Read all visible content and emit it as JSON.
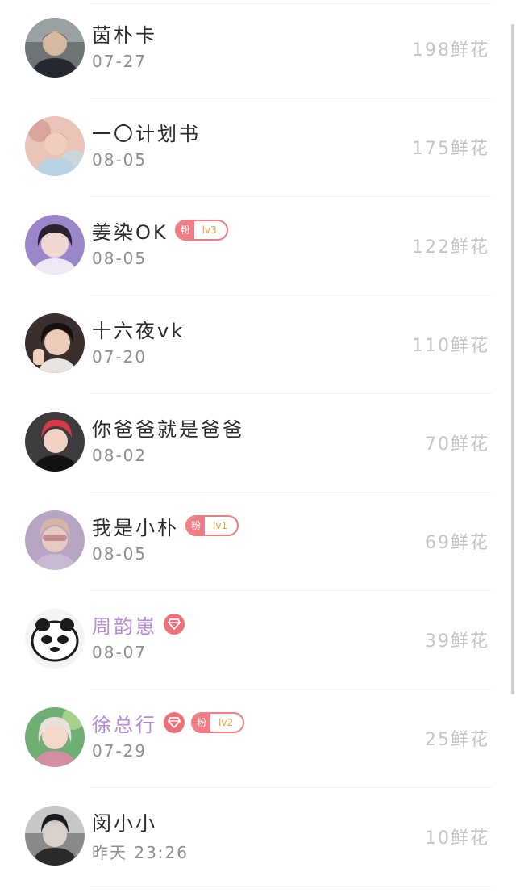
{
  "rows": [
    {
      "name": "茵朴卡",
      "date": "07-27",
      "flowers": "198鲜花",
      "vip": false,
      "fan_tag": "",
      "fan_level": ""
    },
    {
      "name": "一〇计划书",
      "date": "08-05",
      "flowers": "175鲜花",
      "vip": false,
      "fan_tag": "",
      "fan_level": ""
    },
    {
      "name": "姜染OK",
      "date": "08-05",
      "flowers": "122鲜花",
      "vip": false,
      "fan_tag": "粉",
      "fan_level": "lv3"
    },
    {
      "name": "十六夜vk",
      "date": "07-20",
      "flowers": "110鲜花",
      "vip": false,
      "fan_tag": "",
      "fan_level": ""
    },
    {
      "name": "你爸爸就是爸爸",
      "date": "08-02",
      "flowers": "70鲜花",
      "vip": false,
      "fan_tag": "",
      "fan_level": ""
    },
    {
      "name": "我是小朴",
      "date": "08-05",
      "flowers": "69鲜花",
      "vip": false,
      "fan_tag": "粉",
      "fan_level": "lv1"
    },
    {
      "name": "周韵崽",
      "date": "08-07",
      "flowers": "39鲜花",
      "vip": true,
      "fan_tag": "",
      "fan_level": ""
    },
    {
      "name": "徐总行",
      "date": "07-29",
      "flowers": "25鲜花",
      "vip": true,
      "fan_tag": "粉",
      "fan_level": "lv2"
    },
    {
      "name": "闵小小",
      "date": "昨天 23:26",
      "flowers": "10鲜花",
      "vip": false,
      "fan_tag": "",
      "fan_level": ""
    }
  ],
  "colors": {
    "vip_name": "#b58ad9",
    "fan_badge": "#f07c85",
    "fan_level_text": "#e7a03c",
    "diamond_badge": "#ef6f78",
    "flowers_text": "#c4c4c8",
    "date_text": "#8d8d92"
  },
  "icons": {
    "vip": "diamond-icon",
    "avatar": "user-avatar-photo"
  }
}
